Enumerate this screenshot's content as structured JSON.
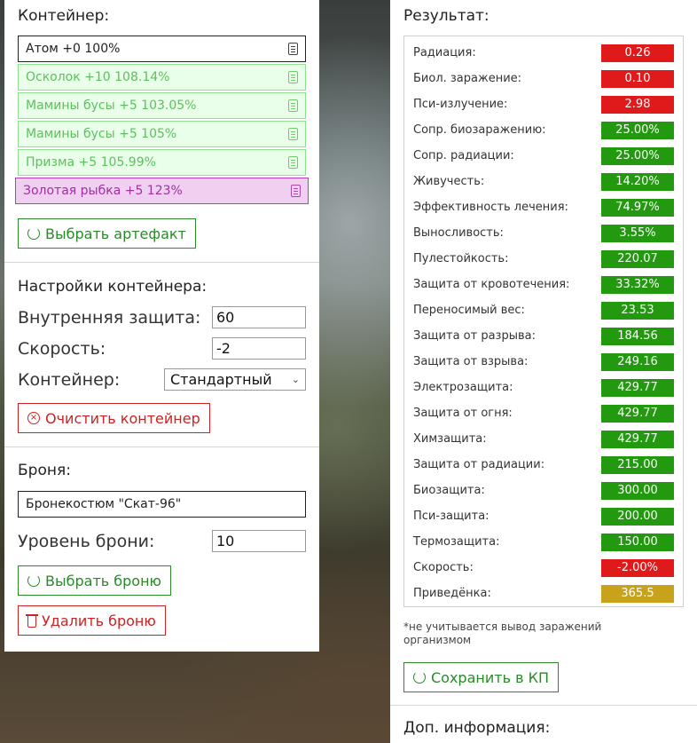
{
  "container": {
    "title": "Контейнер:",
    "artifacts": [
      {
        "label": "Атом +0 100%",
        "style": "plain"
      },
      {
        "label": "Осколок +10 108.14%",
        "style": "green"
      },
      {
        "label": "Мамины бусы +5 103.05%",
        "style": "green"
      },
      {
        "label": "Мамины бусы +5 105%",
        "style": "green"
      },
      {
        "label": "Призма +5 105.99%",
        "style": "green"
      },
      {
        "label": "Золотая рыбка +5 123%",
        "style": "purple"
      }
    ],
    "select_button": "Выбрать артефакт"
  },
  "settings": {
    "title": "Настройки контейнера:",
    "protection_label": "Внутренняя защита:",
    "protection_value": "60",
    "speed_label": "Скорость:",
    "speed_value": "-2",
    "container_label": "Контейнер:",
    "container_value": "Стандартный",
    "clear_button": "Очистить контейнер"
  },
  "armor": {
    "title": "Броня:",
    "name": "Бронекостюм \"Скат-96\"",
    "level_label": "Уровень брони:",
    "level_value": "10",
    "select_button": "Выбрать броню",
    "delete_button": "Удалить броню"
  },
  "result": {
    "title": "Результат:",
    "stats": [
      {
        "label": "Радиация:",
        "value": "0.26",
        "color": "#e0191b"
      },
      {
        "label": "Биол. заражение:",
        "value": "0.10",
        "color": "#e0191b"
      },
      {
        "label": "Пси-излучение:",
        "value": "2.98",
        "color": "#e0191b"
      },
      {
        "label": "Сопр. биозаражению:",
        "value": "25.00%",
        "color": "#22990f"
      },
      {
        "label": "Сопр. радиации:",
        "value": "25.00%",
        "color": "#22990f"
      },
      {
        "label": "Живучесть:",
        "value": "14.20%",
        "color": "#22990f"
      },
      {
        "label": "Эффективность лечения:",
        "value": "74.97%",
        "color": "#22990f"
      },
      {
        "label": "Выносливость:",
        "value": "3.55%",
        "color": "#22990f"
      },
      {
        "label": "Пулестойкость:",
        "value": "220.07",
        "color": "#22990f"
      },
      {
        "label": "Защита от кровотечения:",
        "value": "33.32%",
        "color": "#22990f"
      },
      {
        "label": "Переносимый вес:",
        "value": "23.53",
        "color": "#22990f"
      },
      {
        "label": "Защита от разрыва:",
        "value": "184.56",
        "color": "#22990f"
      },
      {
        "label": "Защита от взрыва:",
        "value": "249.16",
        "color": "#22990f"
      },
      {
        "label": "Электрозащита:",
        "value": "429.77",
        "color": "#22990f"
      },
      {
        "label": "Защита от огня:",
        "value": "429.77",
        "color": "#22990f"
      },
      {
        "label": "Химзащита:",
        "value": "429.77",
        "color": "#22990f"
      },
      {
        "label": "Защита от радиации:",
        "value": "215.00",
        "color": "#22990f"
      },
      {
        "label": "Биозащита:",
        "value": "300.00",
        "color": "#22990f"
      },
      {
        "label": "Пси-защита:",
        "value": "200.00",
        "color": "#22990f"
      },
      {
        "label": "Термозащита:",
        "value": "150.00",
        "color": "#22990f"
      },
      {
        "label": "Скорость:",
        "value": "-2.00%",
        "color": "#e0191b"
      },
      {
        "label": "Приведёнка:",
        "value": "365.5",
        "color": "#c8a21a"
      }
    ],
    "note_line1": "*не учитывается вывод заражений",
    "note_line2": "организмом",
    "save_button": "Сохранить в КП"
  },
  "extra": {
    "title": "Доп. информация:"
  }
}
